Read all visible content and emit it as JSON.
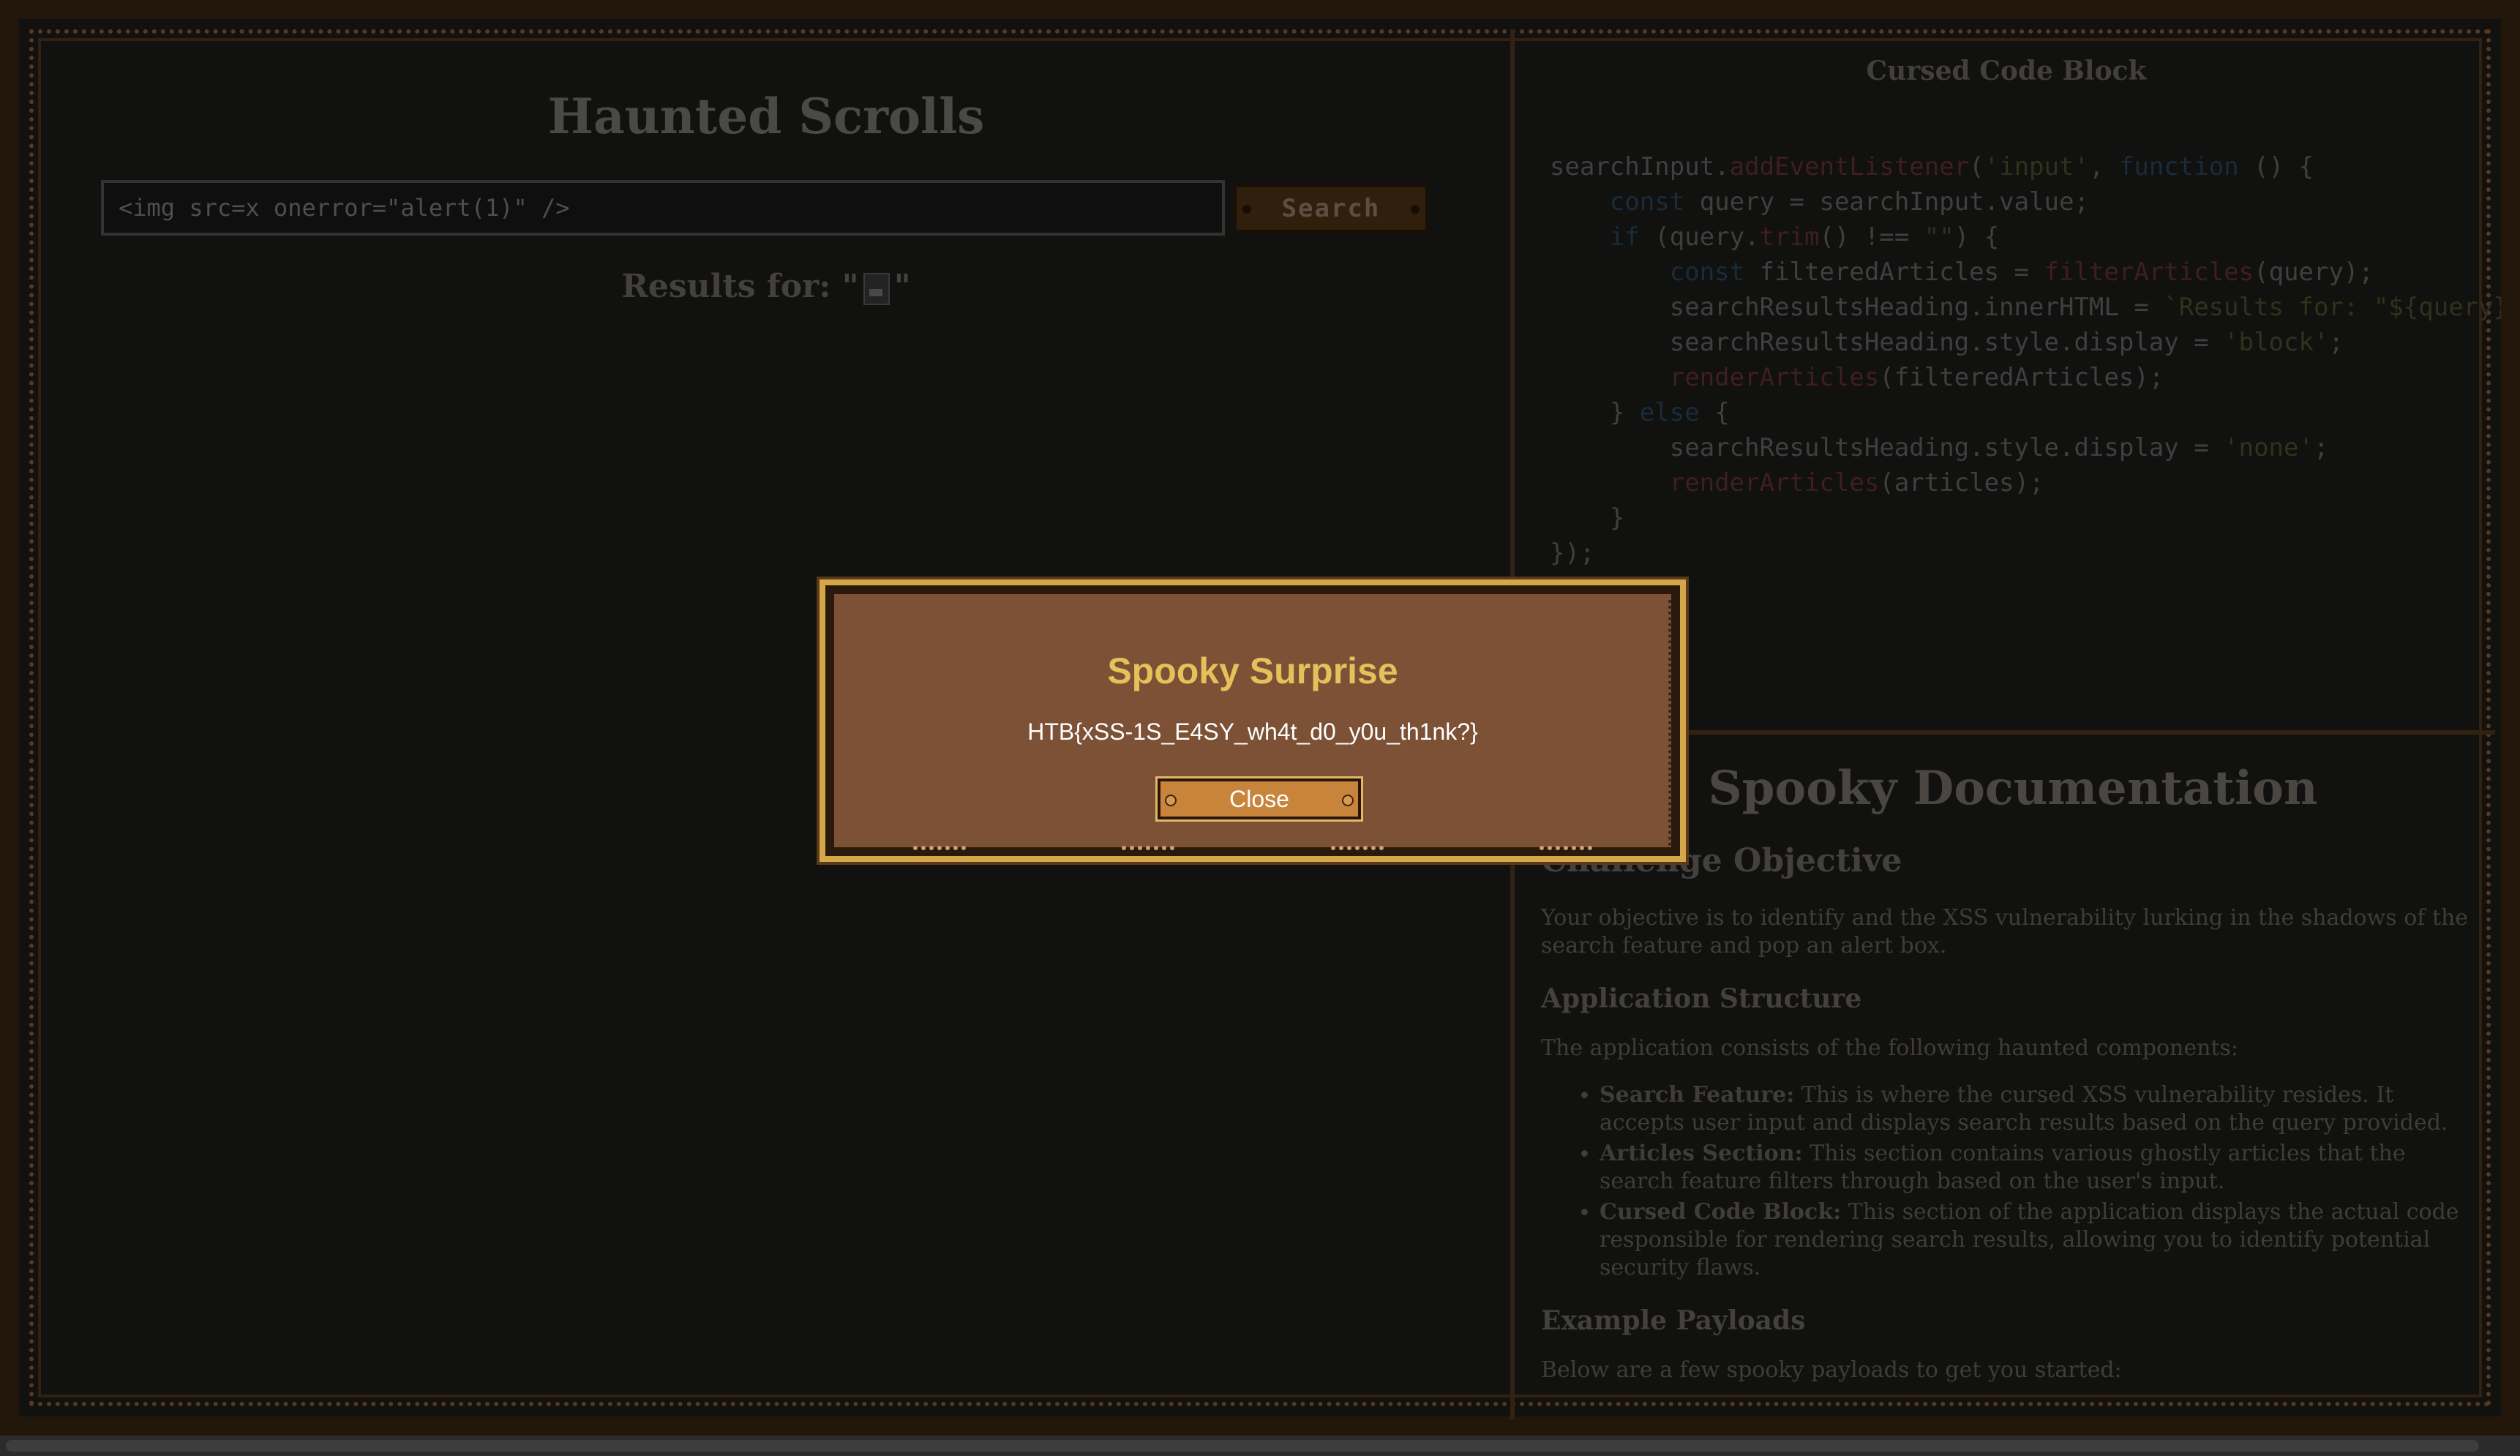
{
  "left": {
    "title": "Haunted Scrolls",
    "search": {
      "value": "<img src=x onerror=\"alert(1)\" />"
    },
    "search_button": "Search",
    "results_prefix": "Results for: \"",
    "results_suffix": "\""
  },
  "code_block": {
    "title": "Cursed Code Block",
    "lines": [
      "searchInput.addEventListener('input', function () {",
      "    const query = searchInput.value;",
      "    if (query.trim() !== \"\") {",
      "        const filteredArticles = filterArticles(query);",
      "        searchResultsHeading.innerHTML = `Results for: \"${query}\"`;",
      "        searchResultsHeading.style.display = 'block';",
      "        renderArticles(filteredArticles);",
      "    } else {",
      "        searchResultsHeading.style.display = 'none';",
      "        renderArticles(articles);",
      "    }",
      "});"
    ]
  },
  "docs": {
    "title": "Spooky Documentation",
    "objective_heading": "Challenge Objective",
    "objective_text": "Your objective is to identify and the XSS vulnerability lurking in the shadows of the search feature and pop an alert box.",
    "structure_heading": "Application Structure",
    "structure_intro": "The application consists of the following haunted components:",
    "components": [
      {
        "name": "Search Feature:",
        "desc": " This is where the cursed XSS vulnerability resides. It accepts user input and displays search results based on the query provided."
      },
      {
        "name": "Articles Section:",
        "desc": " This section contains various ghostly articles that the search feature filters through based on the user's input."
      },
      {
        "name": "Cursed Code Block:",
        "desc": " This section of the application displays the actual code responsible for rendering search results, allowing you to identify potential security flaws."
      }
    ],
    "payloads_heading": "Example Payloads",
    "payloads_intro": "Below are a few spooky payloads to get you started:"
  },
  "modal": {
    "title": "Spooky Surprise",
    "message": "HTB{xSS-1S_E4SY_wh4t_d0_y0u_th1nk?}",
    "close_label": "Close"
  },
  "colors": {
    "modal_bg": "#7c5135",
    "modal_border": "#d4a84a",
    "modal_title": "#e6c05a",
    "button_bg": "#c8843a"
  }
}
